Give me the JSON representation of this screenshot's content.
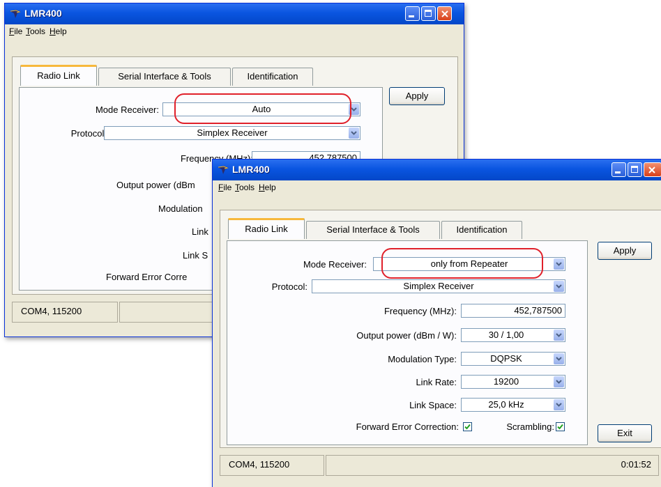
{
  "app_title": "LMR400",
  "menu": [
    {
      "accel": "F",
      "rest": "ile"
    },
    {
      "accel": "T",
      "rest": "ools"
    },
    {
      "accel": "H",
      "rest": "elp"
    }
  ],
  "tabs": [
    "Radio Link",
    "Serial Interface & Tools",
    "Identification"
  ],
  "apply_label": "Apply",
  "exit_label": "Exit",
  "back_window": {
    "mode_receiver_label": "Mode Receiver:",
    "mode_receiver_value": "Auto",
    "protocol_label": "Protocol:",
    "protocol_value": "Simplex Receiver",
    "frequency_label": "Frequency (MHz):",
    "frequency_value": "452,787500",
    "output_power_label": "Output power (dBm",
    "modulation_label": "Modulation",
    "link_rate_label": "Link",
    "link_space_label": "Link S",
    "fec_label": "Forward Error Corre",
    "status_port": "COM4, 115200"
  },
  "front_window": {
    "mode_receiver_label": "Mode Receiver:",
    "mode_receiver_value": "only from Repeater",
    "protocol_label": "Protocol:",
    "protocol_value": "Simplex Receiver",
    "frequency_label": "Frequency (MHz):",
    "frequency_value": "452,787500",
    "output_power_label": "Output power (dBm / W):",
    "output_power_value": "30 / 1,00",
    "modulation_label": "Modulation Type:",
    "modulation_value": "DQPSK",
    "link_rate_label": "Link Rate:",
    "link_rate_value": "19200",
    "link_space_label": "Link Space:",
    "link_space_value": "25,0 kHz",
    "fec_label": "Forward Error Correction:",
    "fec_checked": true,
    "scrambling_label": "Scrambling:",
    "scrambling_checked": true,
    "status_port": "COM4, 115200",
    "status_time": "0:01:52"
  },
  "colors": {
    "highlight": "#e0202a",
    "titlebar": "#0a55e0"
  }
}
